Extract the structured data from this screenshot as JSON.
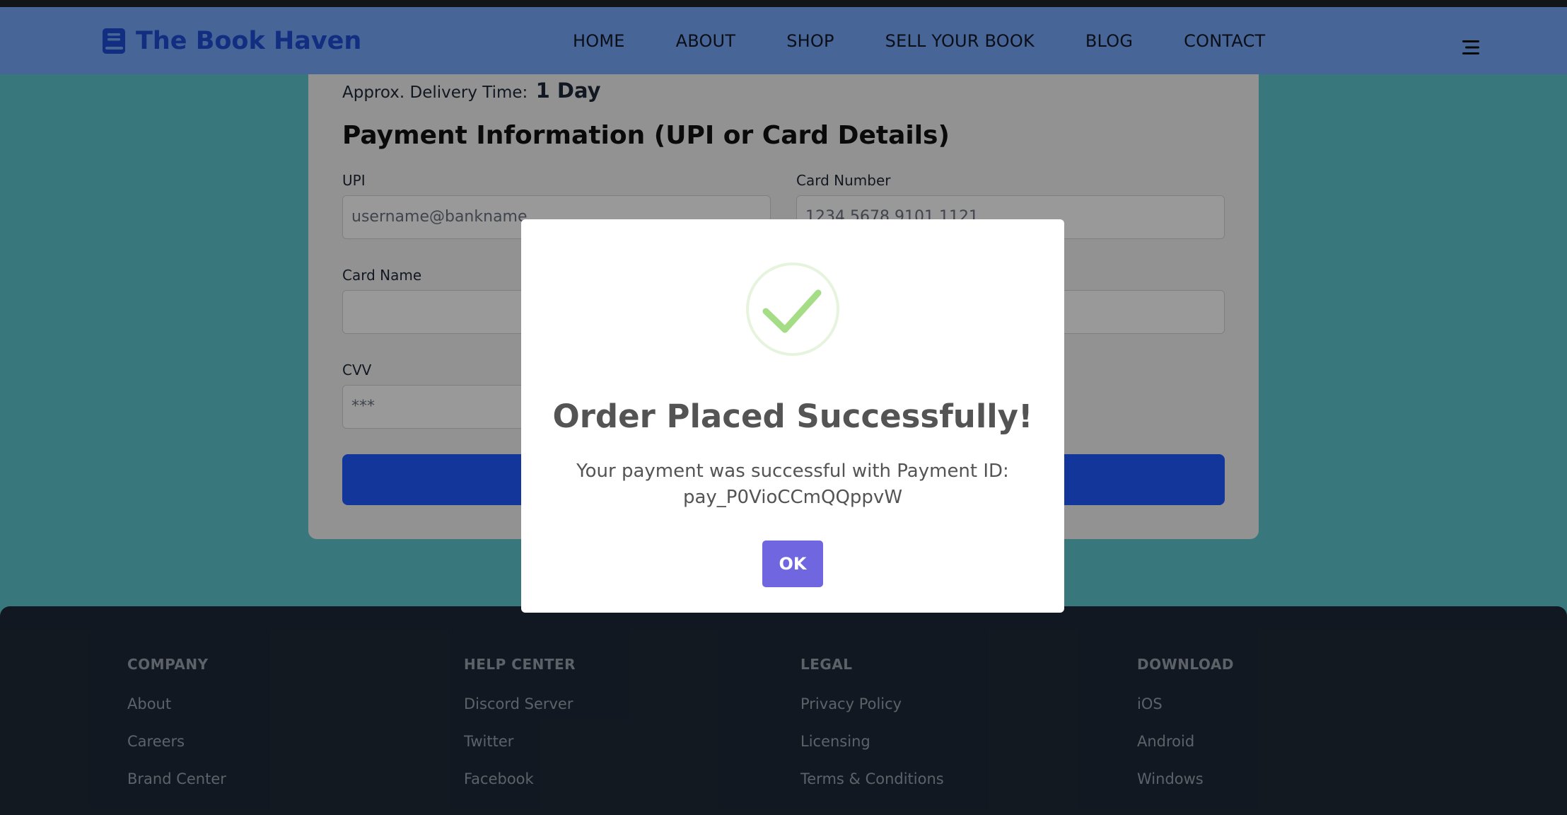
{
  "brand": {
    "name": "The Book Haven"
  },
  "nav": {
    "links": [
      "HOME",
      "ABOUT",
      "SHOP",
      "SELL YOUR BOOK",
      "BLOG",
      "CONTACT"
    ]
  },
  "checkout": {
    "delivery_label": "Approx. Delivery Time:",
    "delivery_value": "1 Day",
    "payment_title": "Payment Information (UPI or Card Details)",
    "upi_label": "UPI",
    "upi_placeholder": "username@bankname",
    "card_number_label": "Card Number",
    "card_number_placeholder": "1234 5678 9101 1121",
    "card_name_label": "Card Name",
    "cvv_label": "CVV",
    "cvv_placeholder": "***"
  },
  "modal": {
    "title": "Order Placed Successfully!",
    "message_line1": "Your payment was successful with Payment ID:",
    "payment_id": "pay_P0VioCCmQQppvW",
    "ok_label": "OK"
  },
  "footer": {
    "columns": [
      {
        "heading": "COMPANY",
        "links": [
          "About",
          "Careers",
          "Brand Center"
        ]
      },
      {
        "heading": "HELP CENTER",
        "links": [
          "Discord Server",
          "Twitter",
          "Facebook"
        ]
      },
      {
        "heading": "LEGAL",
        "links": [
          "Privacy Policy",
          "Licensing",
          "Terms & Conditions"
        ]
      },
      {
        "heading": "DOWNLOAD",
        "links": [
          "iOS",
          "Android",
          "Windows"
        ]
      }
    ]
  },
  "colors": {
    "navbar": "#78a8fd",
    "brand": "#1d4ed8",
    "page_bg": "#5ec8d1",
    "pay_button": "#1e5bff",
    "footer": "#1f2937",
    "ok_button": "#7066e0",
    "success_check": "#a5dc86"
  }
}
